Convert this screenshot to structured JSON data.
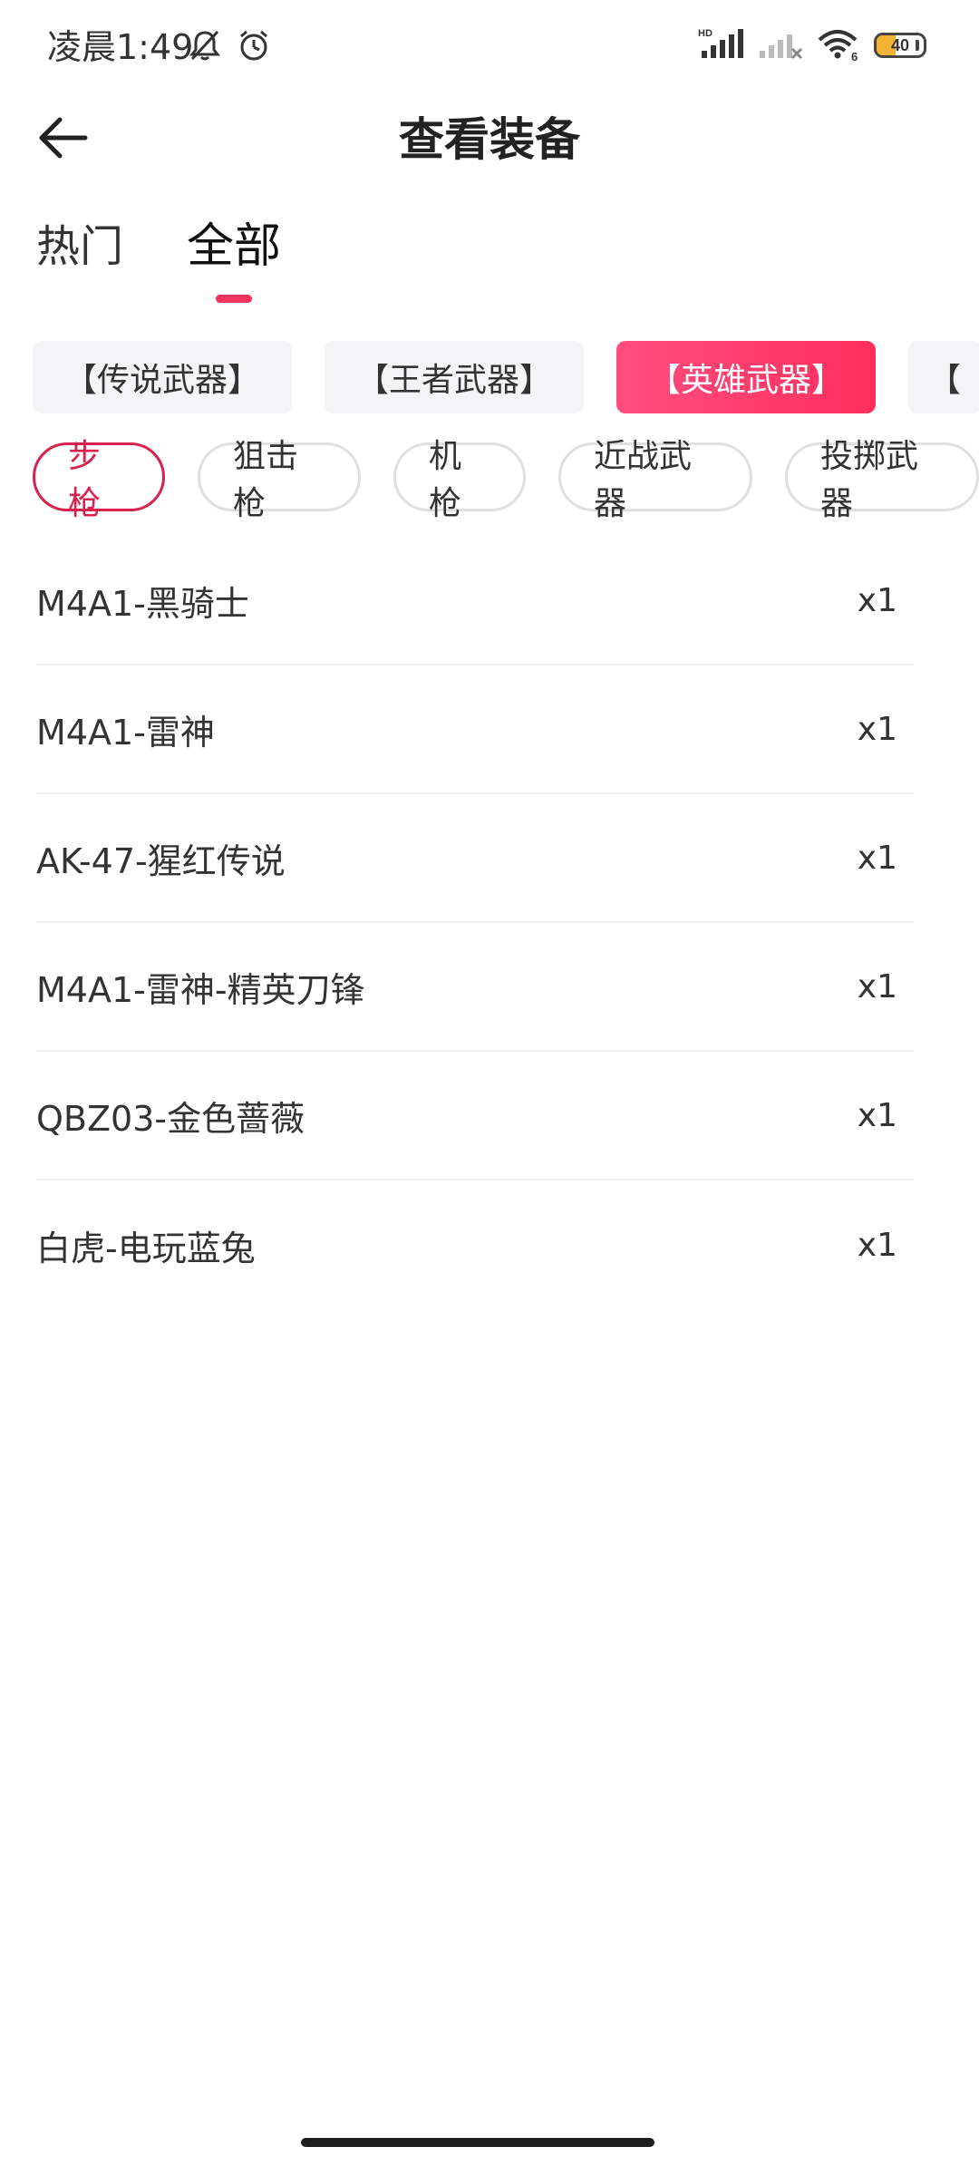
{
  "status_bar": {
    "time": "凌晨1:49",
    "battery_level": "40",
    "battery_fraction": 0.4,
    "icons": [
      "mute-bell-icon",
      "alarm-icon",
      "hd-signal-icon",
      "no-signal-icon",
      "wifi-icon",
      "battery-icon"
    ]
  },
  "header": {
    "title": "查看装备",
    "back_icon": "arrow-left-icon"
  },
  "primary_tabs": [
    {
      "label": "热门",
      "active": false
    },
    {
      "label": "全部",
      "active": true
    }
  ],
  "categories": [
    {
      "label": "【传说武器】",
      "active": false
    },
    {
      "label": "【王者武器】",
      "active": false
    },
    {
      "label": "【英雄武器】",
      "active": true
    },
    {
      "label": "【",
      "active": false
    }
  ],
  "weapon_types": [
    {
      "label": "步枪",
      "active": true
    },
    {
      "label": "狙击枪",
      "active": false
    },
    {
      "label": "机枪",
      "active": false
    },
    {
      "label": "近战武器",
      "active": false
    },
    {
      "label": "投掷武器",
      "active": false
    }
  ],
  "equipment": [
    {
      "name": "M4A1-黑骑士",
      "qty": "x1"
    },
    {
      "name": "M4A1-雷神",
      "qty": "x1"
    },
    {
      "name": "AK-47-猩红传说",
      "qty": "x1"
    },
    {
      "name": "M4A1-雷神-精英刀锋",
      "qty": "x1"
    },
    {
      "name": "QBZ03-金色蔷薇",
      "qty": "x1"
    },
    {
      "name": "白虎-电玩蓝兔",
      "qty": "x1"
    }
  ],
  "colors": {
    "accent": "#f0335f",
    "accent_gradient_start": "#ff4d80",
    "accent_gradient_end": "#ff2e5c",
    "active_pill": "#d8214c",
    "chip_bg": "#f2f4f6"
  }
}
